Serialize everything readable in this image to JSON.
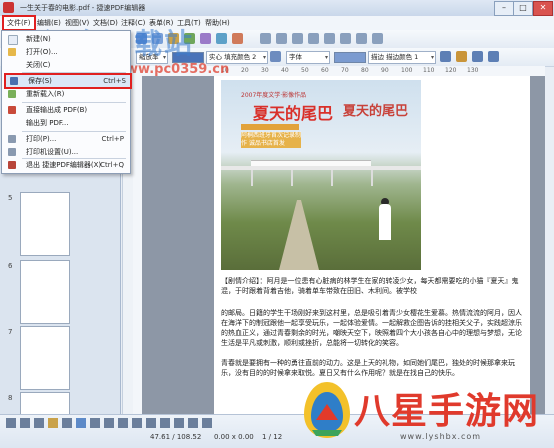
{
  "window": {
    "title": "一生关于春的电影.pdf - 捷速PDF编辑器",
    "minimize": "–",
    "maximize": "□",
    "close": "✕"
  },
  "menubar": {
    "items": [
      "文件(F)",
      "编辑(E)",
      "视图(V)",
      "文档(D)",
      "注释(C)",
      "表单(R)",
      "工具(T)",
      "帮助(H)"
    ]
  },
  "toolbar": {
    "zoom_value": "缩放率",
    "font_name": "字体",
    "fill_label": "实心",
    "fill_color": "填充颜色 2",
    "stroke_label": "描边",
    "stroke_color": "描边颜色 1"
  },
  "watermark": {
    "logo_text": "河东下载站",
    "url_text": "www.pc0359.cn"
  },
  "file_menu": {
    "items": [
      {
        "label": "新建(N)",
        "shortcut": ""
      },
      {
        "label": "打开(O)...",
        "shortcut": ""
      },
      {
        "label": "关闭(C)",
        "shortcut": ""
      },
      {
        "label": "保存(S)",
        "shortcut": "Ctrl+S",
        "highlighted": true
      },
      {
        "label": "重新载入(R)",
        "shortcut": ""
      },
      {
        "label": "直接输出成 PDF(B)",
        "shortcut": ""
      },
      {
        "label": "输出到 PDF...",
        "shortcut": ""
      },
      {
        "label": "打印(P)...",
        "shortcut": "Ctrl+P"
      },
      {
        "label": "打印机设置(U)...",
        "shortcut": ""
      },
      {
        "label": "退出 捷速PDF编辑器(X)",
        "shortcut": "Ctrl+Q"
      }
    ]
  },
  "thumbnails": {
    "pages": [
      "5",
      "6",
      "7",
      "8"
    ]
  },
  "ruler": {
    "ticks": [
      "10",
      "20",
      "30",
      "40",
      "50",
      "60",
      "70",
      "80",
      "90",
      "100",
      "110",
      "120",
      "130"
    ]
  },
  "document": {
    "cover_title_left": "夏天的尾巴",
    "cover_title_right": "夏天的尾巴",
    "cover_banner": "2007年度文学·影像作品",
    "cover_subtitle": "阿桐西班牙首次记录制作 诚品书店首发",
    "paragraphs": [
      "【剧情介绍】：阿月是一位患有心脏病的林学生在家的转凌少女，每天都需要吃的小猫『夏天』鬼混，于时跟着背着吉他，骑着单车带致在田旧、木利间。被学校",
      "的邮局。日籍的学生干场刚好来到这村里，总是吸引着青少女樱花生爱慕。热情流流的阿月，因人在海洋下的制冠跟他一起享受玩乐，一起体验爱情。一起解救企图告诉的挂相关父子，实践超涼乐的热血正义，通过青春剩余的时光，嘲映天空下，映照着四个大小孩各自心中的理想与梦想，无论生活是平凡或刺激，顺利或挫折，总能将一切转化的笑容。",
      "青春就是要拥有一种的勇往直前的动力。这是上天的礼物，如同她们尾巴，独处的时候那拿来玩乐，没有目的的时候拿来取悦。夏日又有什么作用呢？就是在找自己的快乐。"
    ]
  },
  "statusbar": {
    "coords": "47.61 / 108.52",
    "size": "0.00 x 0.00",
    "page_info": "1 / 12"
  },
  "site_badge": {
    "name": "八星手游网",
    "url": "www.lyshbx.com"
  },
  "colors": {
    "accent": "#3d7fd0",
    "highlight_red": "#e02020",
    "brand_red": "#e03a2c"
  }
}
